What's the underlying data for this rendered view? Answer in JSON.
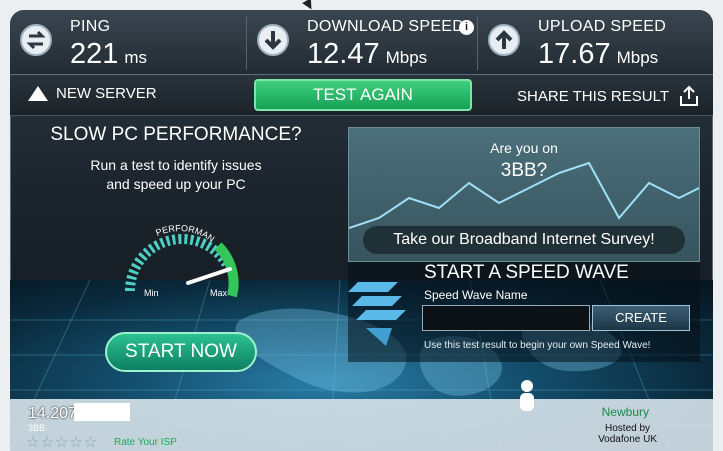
{
  "stats": {
    "ping": {
      "label": "PING",
      "value": "221",
      "unit": "ms",
      "icon": "swap-arrows-icon"
    },
    "download": {
      "label": "DOWNLOAD SPEED",
      "value": "12.47",
      "unit": "Mbps",
      "icon": "down-arrow-icon",
      "info_icon": "info-icon"
    },
    "upload": {
      "label": "UPLOAD SPEED",
      "value": "17.67",
      "unit": "Mbps",
      "icon": "up-arrow-icon"
    }
  },
  "actions": {
    "new_server": "NEW SERVER",
    "test_again": "TEST AGAIN",
    "share": "SHARE THIS RESULT"
  },
  "promo": {
    "title": "SLOW PC PERFORMANCE?",
    "line1": "Run a test to identify issues",
    "line2": "and speed up your PC",
    "gauge_label": "PERFORMANCE",
    "gauge_min": "Min",
    "gauge_max": "Max",
    "start_now": "START NOW"
  },
  "survey": {
    "line1": "Are you on",
    "line2": "3BB?",
    "button": "Take our Broadband Internet Survey!"
  },
  "speed_wave": {
    "title": "START A SPEED WAVE",
    "name_label": "Speed Wave Name",
    "name_value": "",
    "create": "CREATE",
    "hint": "Use this test result to begin your own Speed Wave!"
  },
  "footer": {
    "ip": "14.207.",
    "isp": "3BB",
    "rating_stars": 0,
    "rating_max": 5,
    "rate_label": "Rate Your ISP",
    "city": "Newbury",
    "hosted_by": "Hosted by",
    "host": "Vodafone UK"
  },
  "colors": {
    "accent_green": "#22b566",
    "panel_dark": "#1c252d",
    "map_blue": "#2a7ea8"
  }
}
